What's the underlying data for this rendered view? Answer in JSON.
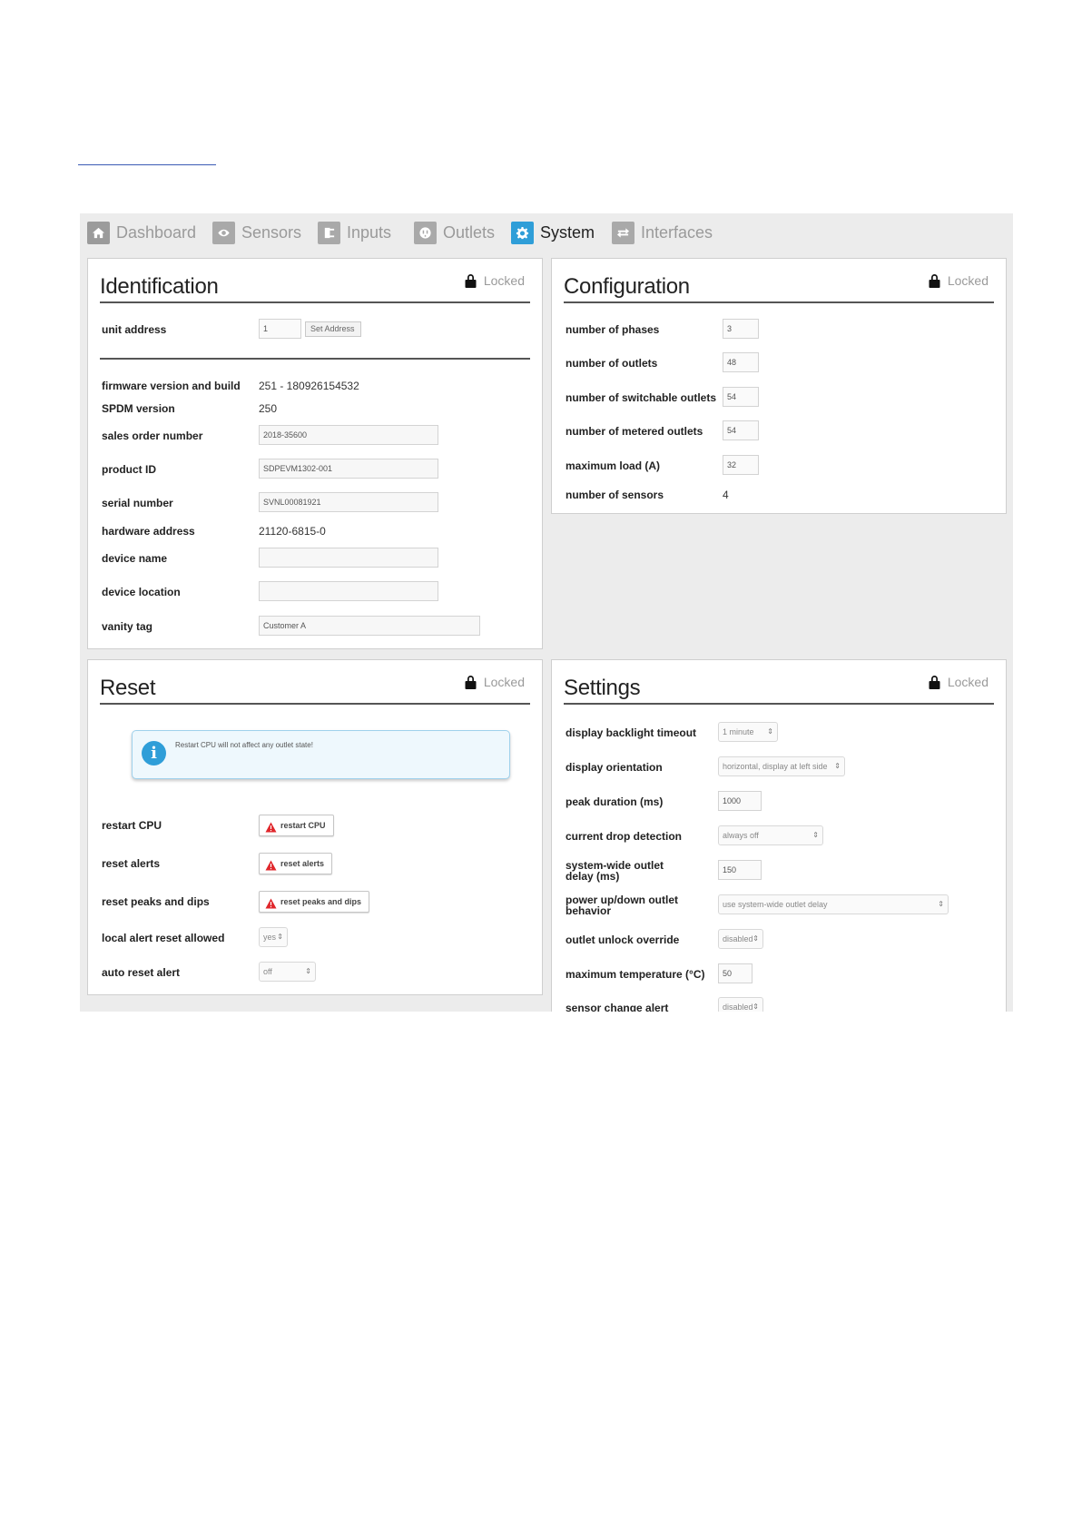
{
  "nav": [
    {
      "label": "Dashboard",
      "icon": "home-icon"
    },
    {
      "label": "Sensors",
      "icon": "eye-icon"
    },
    {
      "label": "Inputs",
      "icon": "plug-icon"
    },
    {
      "label": "Outlets",
      "icon": "outlet-icon"
    },
    {
      "label": "System",
      "icon": "gear-icon"
    },
    {
      "label": "Interfaces",
      "icon": "arrows-icon"
    }
  ],
  "active_tab": "System",
  "lock_label": "Locked",
  "identification": {
    "title": "Identification",
    "unit_address": {
      "label": "unit address",
      "value": "1",
      "button": "Set Address"
    },
    "firmware": {
      "label": "firmware version and build",
      "value": "251 - 180926154532"
    },
    "spdm": {
      "label": "SPDM version",
      "value": "250"
    },
    "sales_order": {
      "label": "sales order number",
      "value": "2018-35600"
    },
    "product_id": {
      "label": "product ID",
      "value": "SDPEVM1302-001"
    },
    "serial": {
      "label": "serial number",
      "value": "SVNL00081921"
    },
    "hardware_address": {
      "label": "hardware address",
      "value": "21120-6815-0"
    },
    "device_name": {
      "label": "device name",
      "value": ""
    },
    "device_location": {
      "label": "device location",
      "value": ""
    },
    "vanity_tag": {
      "label": "vanity tag",
      "value": "Customer A"
    }
  },
  "configuration": {
    "title": "Configuration",
    "phases": {
      "label": "number of phases",
      "value": "3"
    },
    "outlets": {
      "label": "number of outlets",
      "value": "48"
    },
    "switchable": {
      "label": "number of switchable outlets",
      "value": "54"
    },
    "metered": {
      "label": "number of metered outlets",
      "value": "54"
    },
    "max_load": {
      "label": "maximum load (A)",
      "value": "32"
    },
    "sensors": {
      "label": "number of sensors",
      "value": "4"
    }
  },
  "reset": {
    "title": "Reset",
    "info": "Restart CPU will not affect any outlet state!",
    "restart_cpu": {
      "label": "restart CPU",
      "button": "restart CPU"
    },
    "reset_alerts": {
      "label": "reset alerts",
      "button": "reset alerts"
    },
    "reset_peaks": {
      "label": "reset peaks and dips",
      "button": "reset peaks and dips"
    },
    "local_alert": {
      "label": "local alert reset allowed",
      "value": "yes"
    },
    "auto_reset": {
      "label": "auto reset alert",
      "value": "off"
    }
  },
  "settings": {
    "title": "Settings",
    "backlight": {
      "label": "display backlight timeout",
      "value": "1 minute"
    },
    "orientation": {
      "label": "display orientation",
      "value": "horizontal, display at left side"
    },
    "peak_duration": {
      "label": "peak duration (ms)",
      "value": "1000"
    },
    "current_drop": {
      "label": "current drop detection",
      "value": "always off"
    },
    "outlet_delay": {
      "label": "system-wide outlet delay (ms)",
      "value": "150"
    },
    "power_behavior": {
      "label": "power up/down outlet behavior",
      "value": "use system-wide outlet delay"
    },
    "unlock_override": {
      "label": "outlet unlock override",
      "value": "disabled"
    },
    "max_temp": {
      "label": "maximum temperature (°C)",
      "value": "50"
    },
    "sensor_change": {
      "label": "sensor change alert",
      "value": "disabled"
    }
  }
}
